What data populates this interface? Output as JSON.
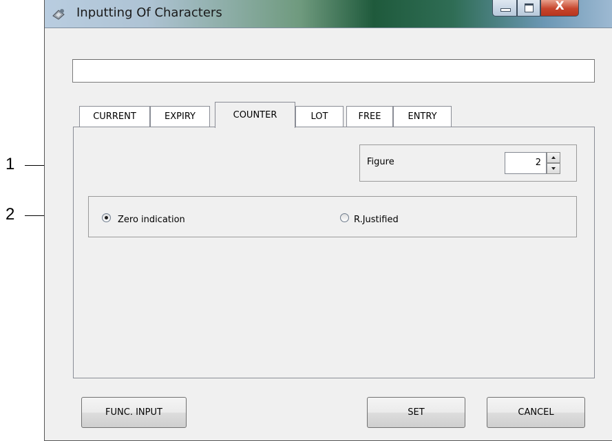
{
  "window": {
    "title": "Inputting Of Characters",
    "close_glyph": "X",
    "app_icon": "keyboard-app-icon"
  },
  "text_input": {
    "value": ""
  },
  "tabs": [
    {
      "label": "CURRENT",
      "active": false
    },
    {
      "label": "EXPIRY",
      "active": false
    },
    {
      "label": "COUNTER",
      "active": true
    },
    {
      "label": "LOT",
      "active": false
    },
    {
      "label": "FREE",
      "active": false
    },
    {
      "label": "ENTRY",
      "active": false
    }
  ],
  "figure": {
    "label": "Figure",
    "value": "2"
  },
  "radios": [
    {
      "label": "Zero indication",
      "checked": true
    },
    {
      "label": "R.Justified",
      "checked": false
    }
  ],
  "callouts": [
    "1",
    "2"
  ],
  "buttons": {
    "func_input": "FUNC. INPUT",
    "set": "SET",
    "cancel": "CANCEL"
  },
  "colors": {
    "close_button": "#c6452c",
    "face": "#f0f0f0",
    "border": "#898c95"
  }
}
